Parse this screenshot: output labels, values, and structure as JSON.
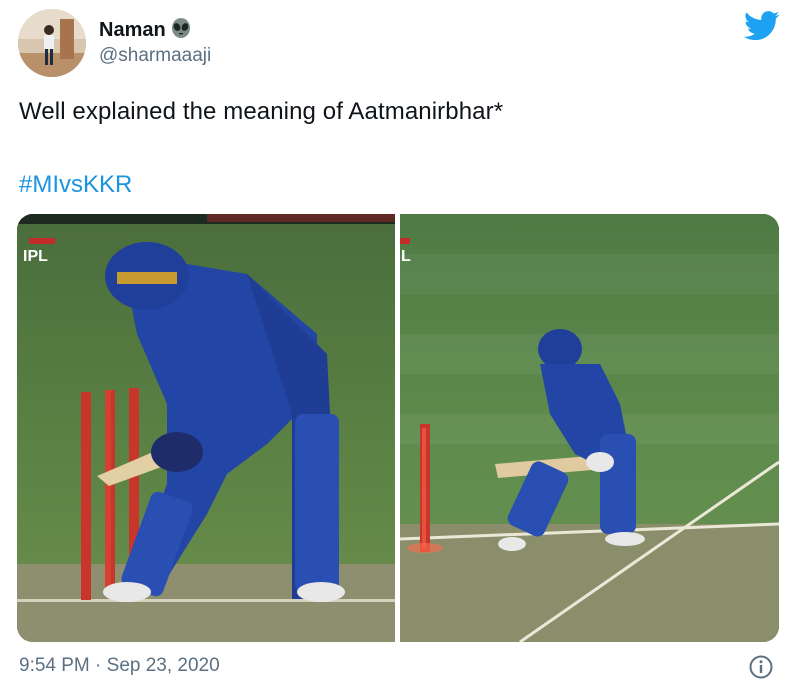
{
  "user": {
    "name": "Naman",
    "handle": "@sharmaaaji",
    "name_emoji_icon": "alien-emoji-icon",
    "avatar_icon": "user-avatar"
  },
  "tweet": {
    "text": "Well explained the meaning of Aatmanirbhar*",
    "hashtag": "#MIvsKKR"
  },
  "media": {
    "left_overlay_label": "IPL",
    "right_overlay_label": "L"
  },
  "footer": {
    "timestamp": "9:54 PM · Sep 23, 2020",
    "info_icon": "info-icon"
  },
  "colors": {
    "link": "#1b95e0",
    "twitter_brand": "#1da1f2",
    "secondary_text": "#5b7083"
  }
}
